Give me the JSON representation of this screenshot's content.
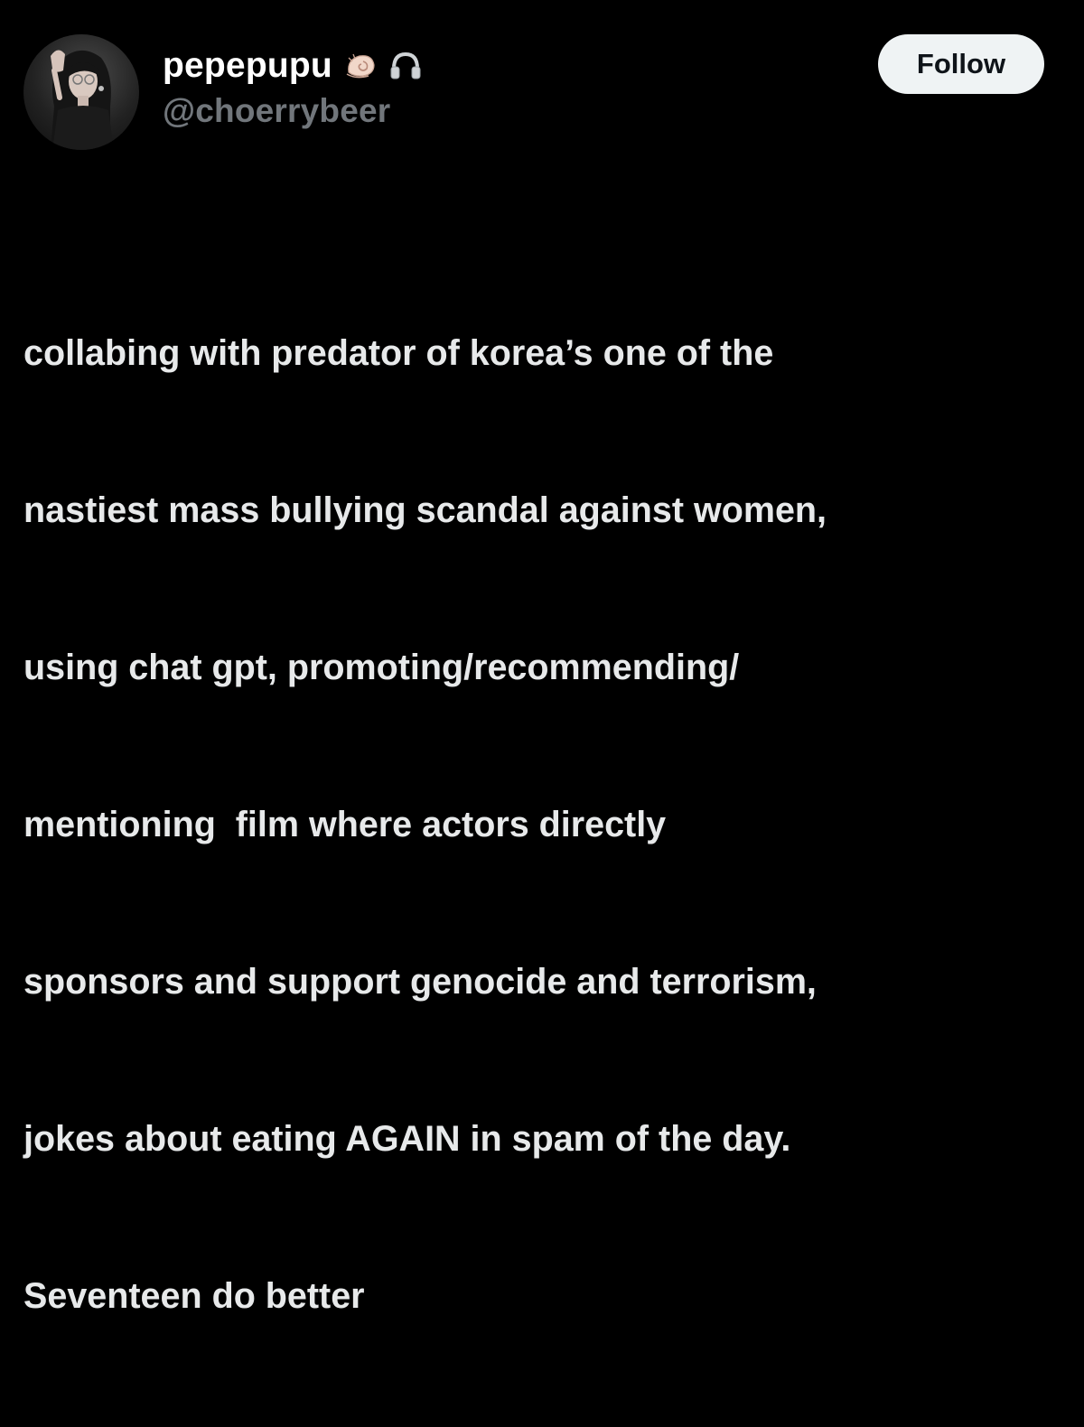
{
  "user": {
    "display_name": "pepepupu",
    "handle": "@choerrybeer",
    "emojis": [
      "spiral-shell-icon",
      "headphones-icon"
    ]
  },
  "actions": {
    "follow_label": "Follow"
  },
  "tweet": {
    "lines": [
      "collabing with predator of korea’s one of the",
      "nastiest mass bullying scandal against women,",
      "using chat gpt, promoting/recommending/",
      "mentioning  film where actors directly",
      "sponsors and support genocide and terrorism,",
      "jokes about eating AGAIN in spam of the day.",
      "Seventeen do better"
    ]
  },
  "colors": {
    "background": "#000000",
    "primary_text": "#e7e9ea",
    "secondary_text": "#71767b",
    "button_bg": "#eff3f4",
    "button_text": "#0f1419"
  }
}
